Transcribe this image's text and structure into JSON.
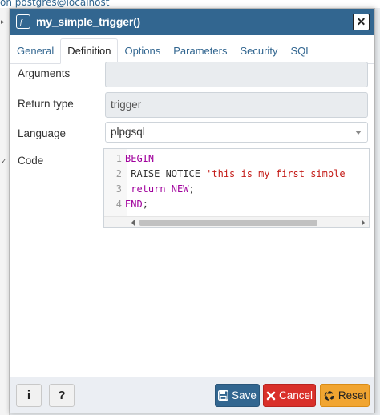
{
  "background": {
    "text": "on postgres@localhost"
  },
  "dialog": {
    "title": "my_simple_trigger()",
    "title_icon": "function-icon",
    "close_icon": "close-icon"
  },
  "tabs": [
    {
      "label": "General",
      "active": false
    },
    {
      "label": "Definition",
      "active": true
    },
    {
      "label": "Options",
      "active": false
    },
    {
      "label": "Parameters",
      "active": false
    },
    {
      "label": "Security",
      "active": false
    },
    {
      "label": "SQL",
      "active": false
    }
  ],
  "form": {
    "arguments": {
      "label": "Arguments",
      "value": ""
    },
    "return_type": {
      "label": "Return type",
      "value": "trigger"
    },
    "language": {
      "label": "Language",
      "value": "plpgsql"
    },
    "code": {
      "label": "Code",
      "lines": [
        {
          "num": "1",
          "t1": "BEGIN",
          "t2": "",
          "t3": ""
        },
        {
          "num": "2",
          "t1": " RAISE NOTICE ",
          "t2": "'this is my first simple",
          "t3": ""
        },
        {
          "num": "3",
          "t1": " return ",
          "t2": "NEW",
          "t3": ";"
        },
        {
          "num": "4",
          "t1": "END",
          "t2": ";",
          "t3": ""
        }
      ]
    }
  },
  "footer": {
    "info_label": "i",
    "help_label": "?",
    "save_label": "Save",
    "cancel_label": "Cancel",
    "reset_label": "Reset"
  },
  "colors": {
    "brand": "#326690",
    "save": "#326690",
    "cancel": "#d9302a",
    "reset": "#f1a531"
  }
}
